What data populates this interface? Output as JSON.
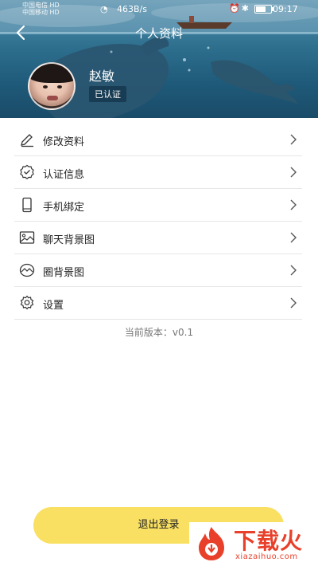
{
  "status_bar": {
    "carrier_line1": "中国电信 HD",
    "carrier_line2": "中国移动 HD",
    "network_speed": "463B/s",
    "battery_level": "64",
    "time": "09:17"
  },
  "header": {
    "title": "个人资料",
    "back_icon": "chevron-left-icon"
  },
  "profile": {
    "name": "赵敏",
    "badge": "已认证"
  },
  "menu": {
    "items": [
      {
        "label": "修改资料",
        "icon": "pencil-icon"
      },
      {
        "label": "认证信息",
        "icon": "shield-check-icon"
      },
      {
        "label": "手机绑定",
        "icon": "phone-icon"
      },
      {
        "label": "聊天背景图",
        "icon": "image-icon"
      },
      {
        "label": "圈背景图",
        "icon": "landscape-icon"
      },
      {
        "label": "设置",
        "icon": "gear-icon"
      }
    ]
  },
  "version_text": "当前版本：v0.1",
  "logout_label": "退出登录",
  "watermark": {
    "brand": "下载火",
    "site": "xiazaihuo.com"
  },
  "colors": {
    "accent": "#f9e062",
    "watermark": "#e8402a",
    "divider": "#e6e6e6"
  }
}
